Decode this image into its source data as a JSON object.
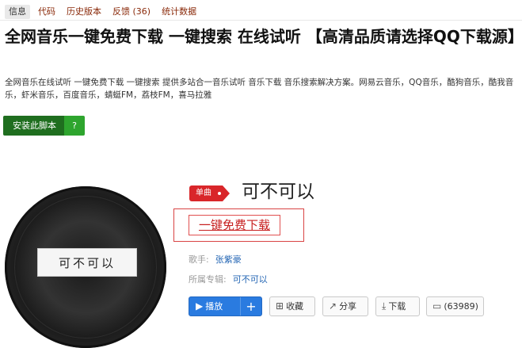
{
  "tabs": [
    "信息",
    "代码",
    "历史版本",
    "反馈 (36)",
    "统计数据"
  ],
  "script": {
    "title": "全网音乐一键免费下载 一键搜索 在线试听 【高清品质请选择QQ下载源】",
    "description": "全网音乐在线试听 一键免费下载 一键搜索 提供多站合一音乐试听 音乐下载 音乐搜索解决方案。网易云音乐，QQ音乐，酷狗音乐，酷我音乐，虾米音乐，百度音乐，蜻蜓FM，荔枝FM，喜马拉雅",
    "install_label": "安装此脚本",
    "install_count": "?"
  },
  "song": {
    "badge": "单曲",
    "title": "可不可以",
    "cover_text": "可不可以",
    "download_link": "一键免费下载",
    "singer_label": "歌手:",
    "singer": "张紫豪",
    "album_label": "所属专辑:",
    "album": "可不可以"
  },
  "actions": {
    "play": "播放",
    "plus": "+",
    "favorite": "收藏",
    "share": "分享",
    "download": "下载",
    "comments": "(63989)"
  },
  "colors": {
    "accent_red": "#d9262a",
    "link_blue": "#2466b4",
    "play_blue": "#2a7be0",
    "install_green": "#1f6e1f"
  }
}
